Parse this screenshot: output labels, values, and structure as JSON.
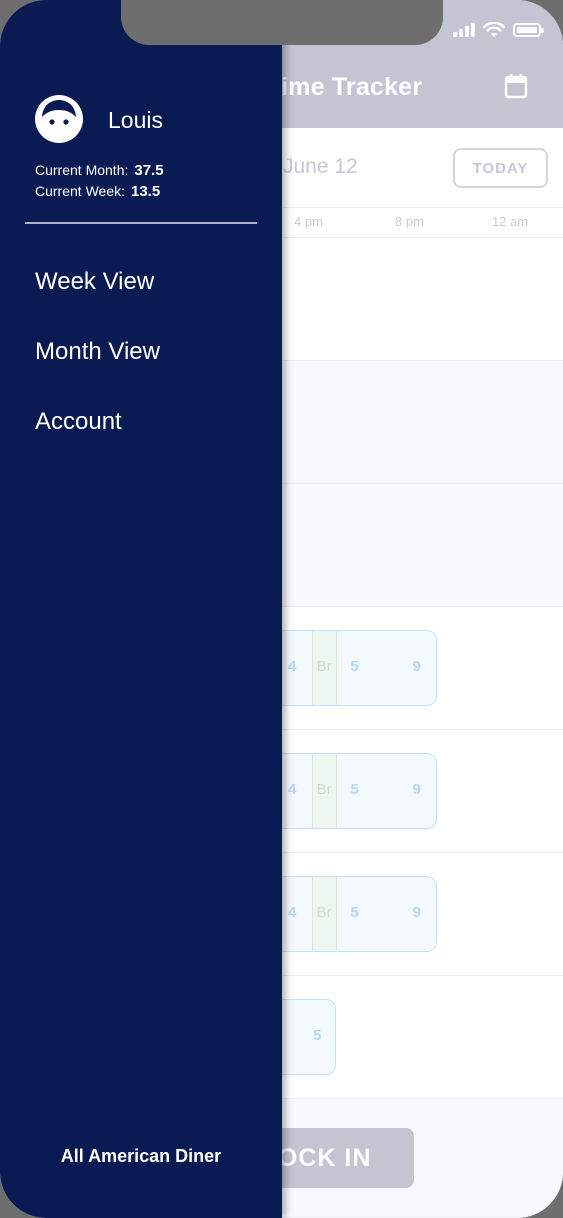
{
  "app": {
    "title": "Time Tracker",
    "date_label": "June 12",
    "today_button": "TODAY",
    "clock_in_label": "CLOCK IN",
    "time_ticks": [
      "4 pm",
      "8 pm",
      "12 am"
    ],
    "shifts": [
      {
        "start": "4",
        "break": "Br",
        "mid": "5",
        "end": "9"
      },
      {
        "start": "4",
        "break": "Br",
        "mid": "5",
        "end": "9"
      },
      {
        "start": "4",
        "break": "Br",
        "mid": "5",
        "end": "9"
      },
      {
        "end": "5"
      }
    ]
  },
  "drawer": {
    "user_name": "Louis",
    "current_month_label": "Current Month:",
    "current_month_value": "37.5",
    "current_week_label": "Current Week:",
    "current_week_value": "13.5",
    "nav_items": [
      "Week View",
      "Month View",
      "Account"
    ],
    "business_name": "All American Diner"
  },
  "colors": {
    "drawer_bg": "#0a1a52",
    "header_bg": "#c3c5d3",
    "shift_border": "#c7e2f6"
  },
  "icons": [
    "signal-icon",
    "wifi-icon",
    "battery-icon",
    "calendar-icon",
    "avatar-face-icon"
  ]
}
